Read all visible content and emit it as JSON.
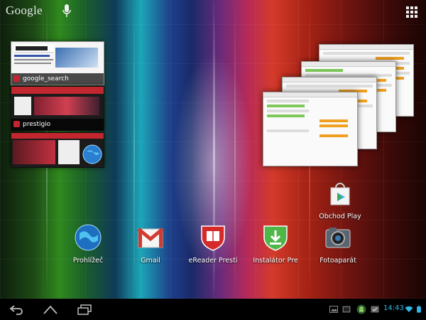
{
  "top_bar": {
    "search_brand": "Google",
    "mic_icon": "microphone-icon",
    "apps_icon": "all-apps-grid-icon"
  },
  "recent_thumbnails": [
    {
      "label": "google_search",
      "favicon": "favicon-icon"
    },
    {
      "label": "prestigio",
      "favicon": "favicon-icon"
    },
    {
      "label": "",
      "favicon": "globe-icon"
    }
  ],
  "home_apps": [
    {
      "label": "Obchod Play",
      "icon": "play-store-icon"
    },
    {
      "label": "Prohlížeč",
      "icon": "browser-globe-icon"
    },
    {
      "label": "Gmail",
      "icon": "gmail-icon"
    },
    {
      "label": "eReader Presti",
      "icon": "ereader-shield-icon"
    },
    {
      "label": "Instalátor Pre",
      "icon": "installer-icon"
    },
    {
      "label": "Fotoaparát",
      "icon": "camera-icon"
    }
  ],
  "nav_bar": {
    "back_icon": "back-icon",
    "home_icon": "home-icon",
    "recents_icon": "recent-apps-icon",
    "clock": "14:43",
    "clock_color": "#33b5e5",
    "status_icons": [
      "picture-notification-icon",
      "screenshot-icon",
      "android-robot-icon",
      "calendar-icon",
      "wifi-icon",
      "battery-icon"
    ]
  },
  "colors": {
    "nav_background": "#000000",
    "text": "#ffffff"
  }
}
